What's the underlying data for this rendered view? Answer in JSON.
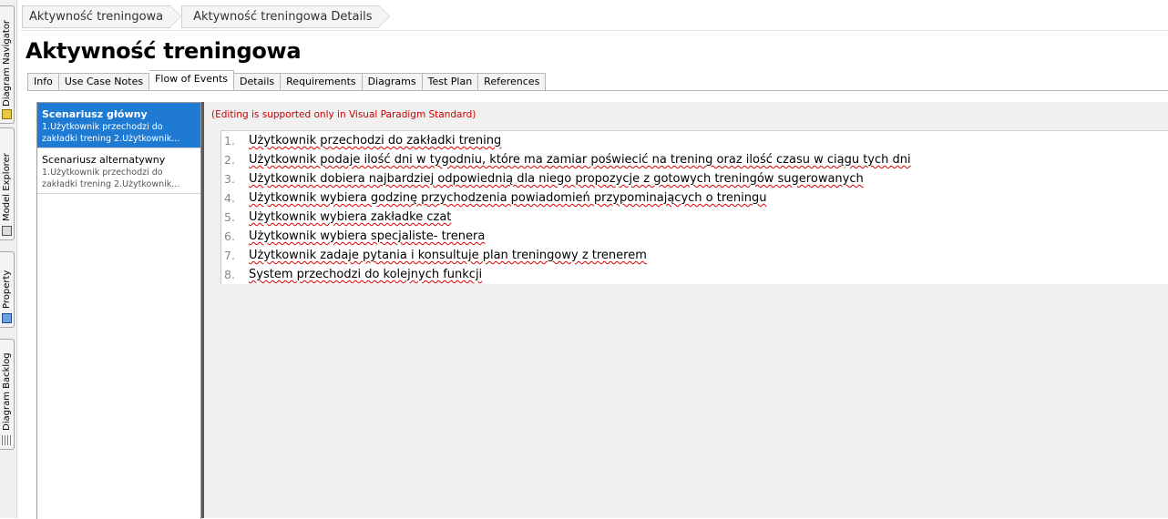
{
  "dock": {
    "tabs": [
      {
        "label": "Diagram Navigator"
      },
      {
        "label": "Model Explorer"
      },
      {
        "label": "Property"
      },
      {
        "label": "Diagram Backlog"
      }
    ]
  },
  "breadcrumb": [
    "Aktywność treningowa",
    "Aktywność treningowa Details"
  ],
  "page_title": "Aktywność treningowa",
  "tabs": [
    "Info",
    "Use Case Notes",
    "Flow of Events",
    "Details",
    "Requirements",
    "Diagrams",
    "Test Plan",
    "References"
  ],
  "active_tab": "Flow of Events",
  "scenarios": [
    {
      "name": "Scenariusz główny",
      "preview": "1.Użytkownik przechodzi do zakładki trening 2.Użytkownik...",
      "selected": true
    },
    {
      "name": "Scenariusz alternatywny",
      "preview": "1.Użytkownik przechodzi do zakładki trening 2.Użytkownik...",
      "selected": false
    }
  ],
  "editing_note": "(Editing is supported only in Visual Paradigm Standard)",
  "steps": [
    {
      "num": "1.",
      "text": "Użytkownik przechodzi do zakładki trening"
    },
    {
      "num": "2.",
      "text": "Użytkownik podaje ilość dni w tygodniu, które ma zamiar poświecić na trening oraz ilość czasu w ciągu tych dni"
    },
    {
      "num": "3.",
      "text": "Użytkownik dobiera najbardziej odpowiednią dla niego propozycje z gotowych treningów sugerowanych"
    },
    {
      "num": "4.",
      "text": "Użytkownik wybiera godzinę przychodzenia powiadomień przypominających o treningu"
    },
    {
      "num": "5.",
      "text": "Użytkownik wybiera zakładke czat"
    },
    {
      "num": "6.",
      "text": "Użytkownik wybiera specjaliste- trenera"
    },
    {
      "num": "7.",
      "text": "Użytkownik zadaje pytania i konsultuje plan treningowy z trenerem"
    },
    {
      "num": "8.",
      "text": "System przechodzi do kolejnych funkcji"
    }
  ],
  "colors": {
    "selection": "#1e7ad2",
    "note_red": "#cc0000"
  }
}
